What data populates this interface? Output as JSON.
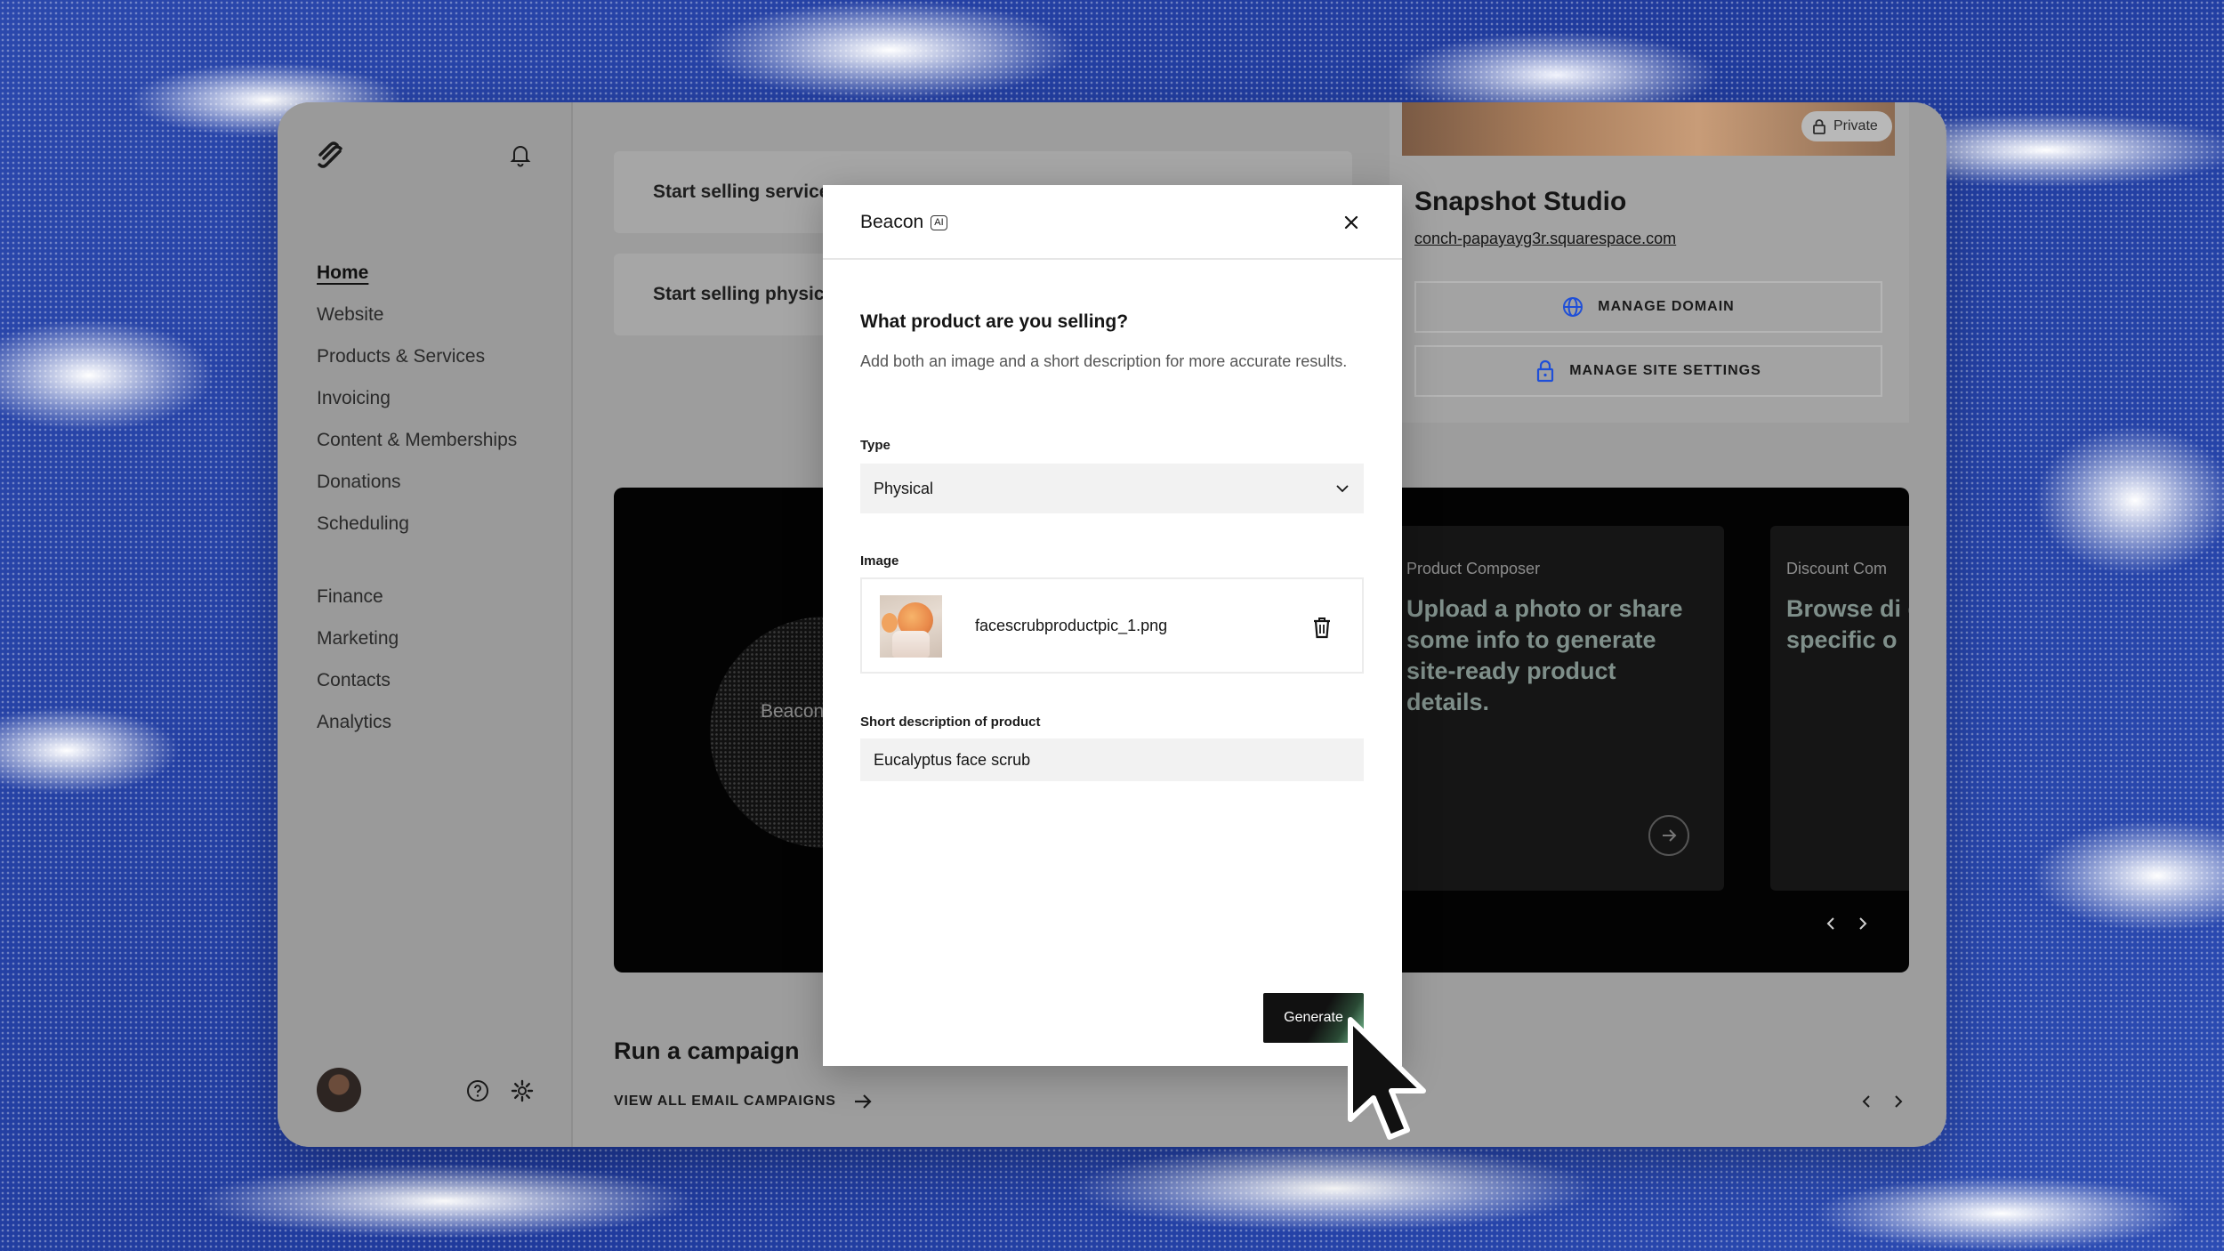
{
  "sidebar": {
    "nav_items": [
      {
        "label": "Home",
        "active": true
      },
      {
        "label": "Website"
      },
      {
        "label": "Products & Services"
      },
      {
        "label": "Invoicing"
      },
      {
        "label": "Content & Memberships"
      },
      {
        "label": "Donations"
      },
      {
        "label": "Scheduling"
      },
      {
        "label": "Finance"
      },
      {
        "label": "Marketing"
      },
      {
        "label": "Contacts"
      },
      {
        "label": "Analytics"
      }
    ]
  },
  "main": {
    "sell_services": "Start selling service",
    "sell_physical": "Start selling physica",
    "site": {
      "private_label": "Private",
      "title": "Snapshot Studio",
      "url": "conch-papayayg3r.squarespace.com",
      "manage_domain": "MANAGE DOMAIN",
      "manage_settings": "MANAGE SITE SETTINGS"
    },
    "beacon_panel": {
      "orb_label": "Beacon",
      "cards": [
        {
          "kicker": "Product Composer",
          "text": "Upload a photo or share some info to generate site-ready product details."
        },
        {
          "kicker": "Discount Com",
          "text": "Browse di designed specific o"
        }
      ]
    },
    "campaign": {
      "title": "Run a campaign",
      "link": "VIEW ALL EMAIL CAMPAIGNS"
    }
  },
  "modal": {
    "title": "Beacon",
    "ai_badge": "AI",
    "question": "What product are you selling?",
    "subtitle": "Add both an image and a short description for more accurate results.",
    "type_label": "Type",
    "type_value": "Physical",
    "image_label": "Image",
    "image_filename": "facescrubproductpic_1.png",
    "desc_label": "Short description of product",
    "desc_value": "Eucalyptus face scrub",
    "generate_label": "Generate"
  },
  "colors": {
    "accent_blue": "#1f4fd8",
    "window_dim": "#9d9d9d",
    "background_blue": "#2a43a3"
  }
}
